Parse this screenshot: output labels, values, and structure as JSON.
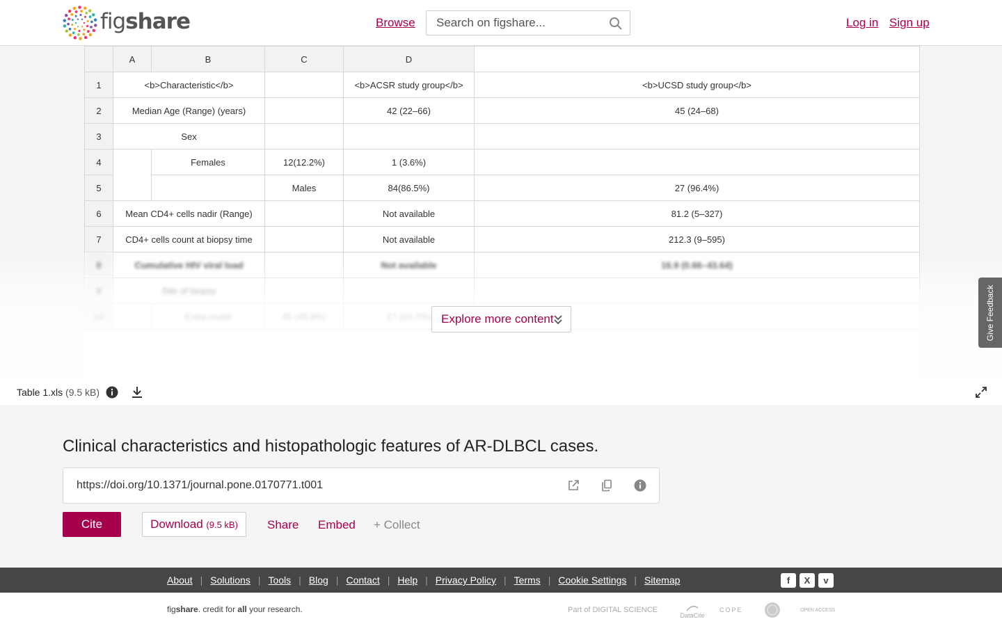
{
  "header": {
    "logo_fig": "fig",
    "logo_share": "share",
    "browse": "Browse",
    "search_placeholder": "Search on figshare...",
    "login": "Log in",
    "signup": "Sign up"
  },
  "sheet": {
    "columns": [
      "A",
      "B",
      "C",
      "D"
    ],
    "rows": [
      {
        "n": "1",
        "ab": "<b>Characteristic</b>",
        "c": "",
        "d": "<b>ACSR study group</b>",
        "e": "<b>UCSD study group</b>"
      },
      {
        "n": "2",
        "ab": "Median Age (Range) (years)",
        "c": "",
        "d": "42 (22–66)",
        "e": "45 (24–68)"
      },
      {
        "n": "3",
        "ab": "Sex",
        "c": "",
        "d": "",
        "e": ""
      },
      {
        "n": "4",
        "b": "Females",
        "c": "12(12.2%)",
        "d": "1 (3.6%)",
        "e": ""
      },
      {
        "n": "5",
        "b": "",
        "c": "Males",
        "d": "84(86.5%)",
        "e": "27 (96.4%)"
      },
      {
        "n": "6",
        "ab": "Mean CD4+ cells nadir (Range)",
        "c": "",
        "d": "Not available",
        "e": "81.2 (5–327)"
      },
      {
        "n": "7",
        "ab": "CD4+ cells count at biopsy time",
        "c": "",
        "d": "Not available",
        "e": "212.3 (9–595)"
      },
      {
        "n": "8",
        "ab": "Cumulative HIV viral load",
        "c": "",
        "d": "Not available",
        "e": "16.9 (0.66–43.64)"
      },
      {
        "n": "9",
        "ab": "Site of biopsy",
        "c": "",
        "d": "",
        "e": ""
      },
      {
        "n": "10",
        "b": "Extra-nodal",
        "c": "45 (45.9%)",
        "d": "17 (60.7%)",
        "e": ""
      }
    ],
    "explore": "Explore more content"
  },
  "feedback": "Give Feedback",
  "file": {
    "name": "Table 1.xls",
    "size": "(9.5 kB)"
  },
  "details": {
    "title": "Clinical characteristics and histopathologic features of AR-DLBCL cases.",
    "doi": "https://doi.org/10.1371/journal.pone.0170771.t001",
    "cite": "Cite",
    "download": "Download",
    "download_size": "(9.5 kB)",
    "share": "Share",
    "embed": "Embed",
    "collect": "+ Collect"
  },
  "footer": {
    "links": [
      "About",
      "Solutions",
      "Tools",
      "Blog",
      "Contact",
      "Help",
      "Privacy Policy",
      "Terms",
      "Cookie Settings",
      "Sitemap"
    ],
    "tagline_fig": "fig",
    "tagline_share": "share",
    "tagline_mid": ". credit for ",
    "tagline_all": "all",
    "tagline_end": " your research.",
    "partners": [
      "Part of DIGITAL SCIENCE",
      "DataCite",
      "COPE",
      "",
      "OPEN ACCESS"
    ]
  },
  "icons": {
    "search": "search-icon",
    "info": "info-icon",
    "download": "download-icon",
    "expand": "expand-icon",
    "external": "external-link-icon",
    "copy": "copy-icon",
    "chevron": "double-chevron-down-icon",
    "facebook": "facebook-icon",
    "x": "x-icon",
    "vimeo": "vimeo-icon"
  },
  "colors": {
    "accent": "#a5004c",
    "footer": "#464646"
  }
}
